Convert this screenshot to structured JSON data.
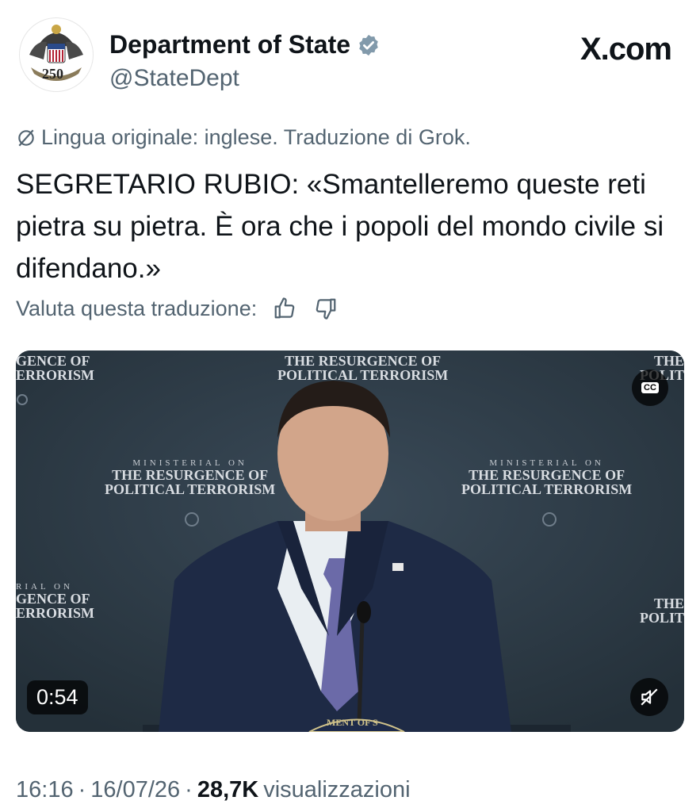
{
  "header": {
    "display_name": "Department of State",
    "handle": "@StateDept",
    "brand": "X.com",
    "seal_number": "250"
  },
  "translation_note": "Lingua originale: inglese. Traduzione di Grok.",
  "post_text": "SEGRETARIO RUBIO: «Smantelleremo queste reti pietra su pietra. È ora che i popoli del mondo civile si difendano.»",
  "rate": {
    "label": "Valuta questa traduzione:"
  },
  "media": {
    "duration": "0:54",
    "cc_label": "CC",
    "backdrop": {
      "ministerial": "MINISTERIAL ON",
      "line1": "THE RESURGENCE OF",
      "line2": "POLITICAL TERRORISM",
      "cut_gence": "GENCE OF",
      "cut_terrorism": "ERRORISM",
      "cut_the": "THE",
      "cut_polit": "POLIT",
      "cut_rial_on": "RIAL ON",
      "podium_text": "MENT OF S"
    }
  },
  "meta": {
    "time": "16:16",
    "date": "16/07/26",
    "views_count": "28,7K",
    "views_label": "visualizzazioni",
    "separator": "·"
  },
  "colors": {
    "text": "#0f1419",
    "muted": "#536471",
    "verified": "#829aab",
    "backdrop": "#2c3a47"
  }
}
